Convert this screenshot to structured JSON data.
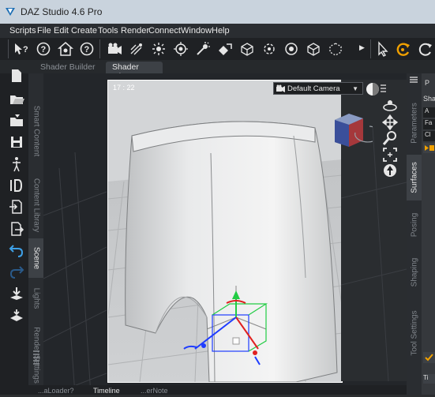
{
  "window": {
    "title": "DAZ Studio 4.6 Pro"
  },
  "menu": {
    "items": [
      "Scripts",
      "File",
      "Edit",
      "Create",
      "Tools",
      "Render",
      "Connect",
      "Window",
      "Help"
    ]
  },
  "tabs": [
    {
      "label": "Shader Builder",
      "active": false
    },
    {
      "label": "Shader Mixer",
      "active": true
    }
  ],
  "left_panes": [
    {
      "label": "Smart Content",
      "active": false
    },
    {
      "label": "Content Library",
      "active": false
    },
    {
      "label": "Scene",
      "active": true
    },
    {
      "label": "Lights",
      "active": false
    },
    {
      "label": "Render Settings",
      "active": false
    }
  ],
  "right_panes": [
    {
      "label": "Parameters",
      "active": false
    },
    {
      "label": "Surfaces",
      "active": true
    },
    {
      "label": "Posing",
      "active": false
    },
    {
      "label": "Shaping",
      "active": false
    },
    {
      "label": "Tool Settings",
      "active": false
    }
  ],
  "right_panel": {
    "header": "P",
    "section": "Sha",
    "rows": [
      "A",
      "Fa",
      "Cl"
    ]
  },
  "viewport": {
    "frame_counter": "17 : 22",
    "camera": "Default Camera"
  },
  "bottom_tabs": [
    {
      "label": "...aLoader?",
      "active": false
    },
    {
      "label": "Timeline",
      "active": true
    },
    {
      "label": "...erNote",
      "active": false
    }
  ],
  "colors": {
    "accent": "#f0a000",
    "titlebar": "#c9d3dd",
    "panel": "#2c2e30",
    "viewport": "#d5d7d9"
  }
}
